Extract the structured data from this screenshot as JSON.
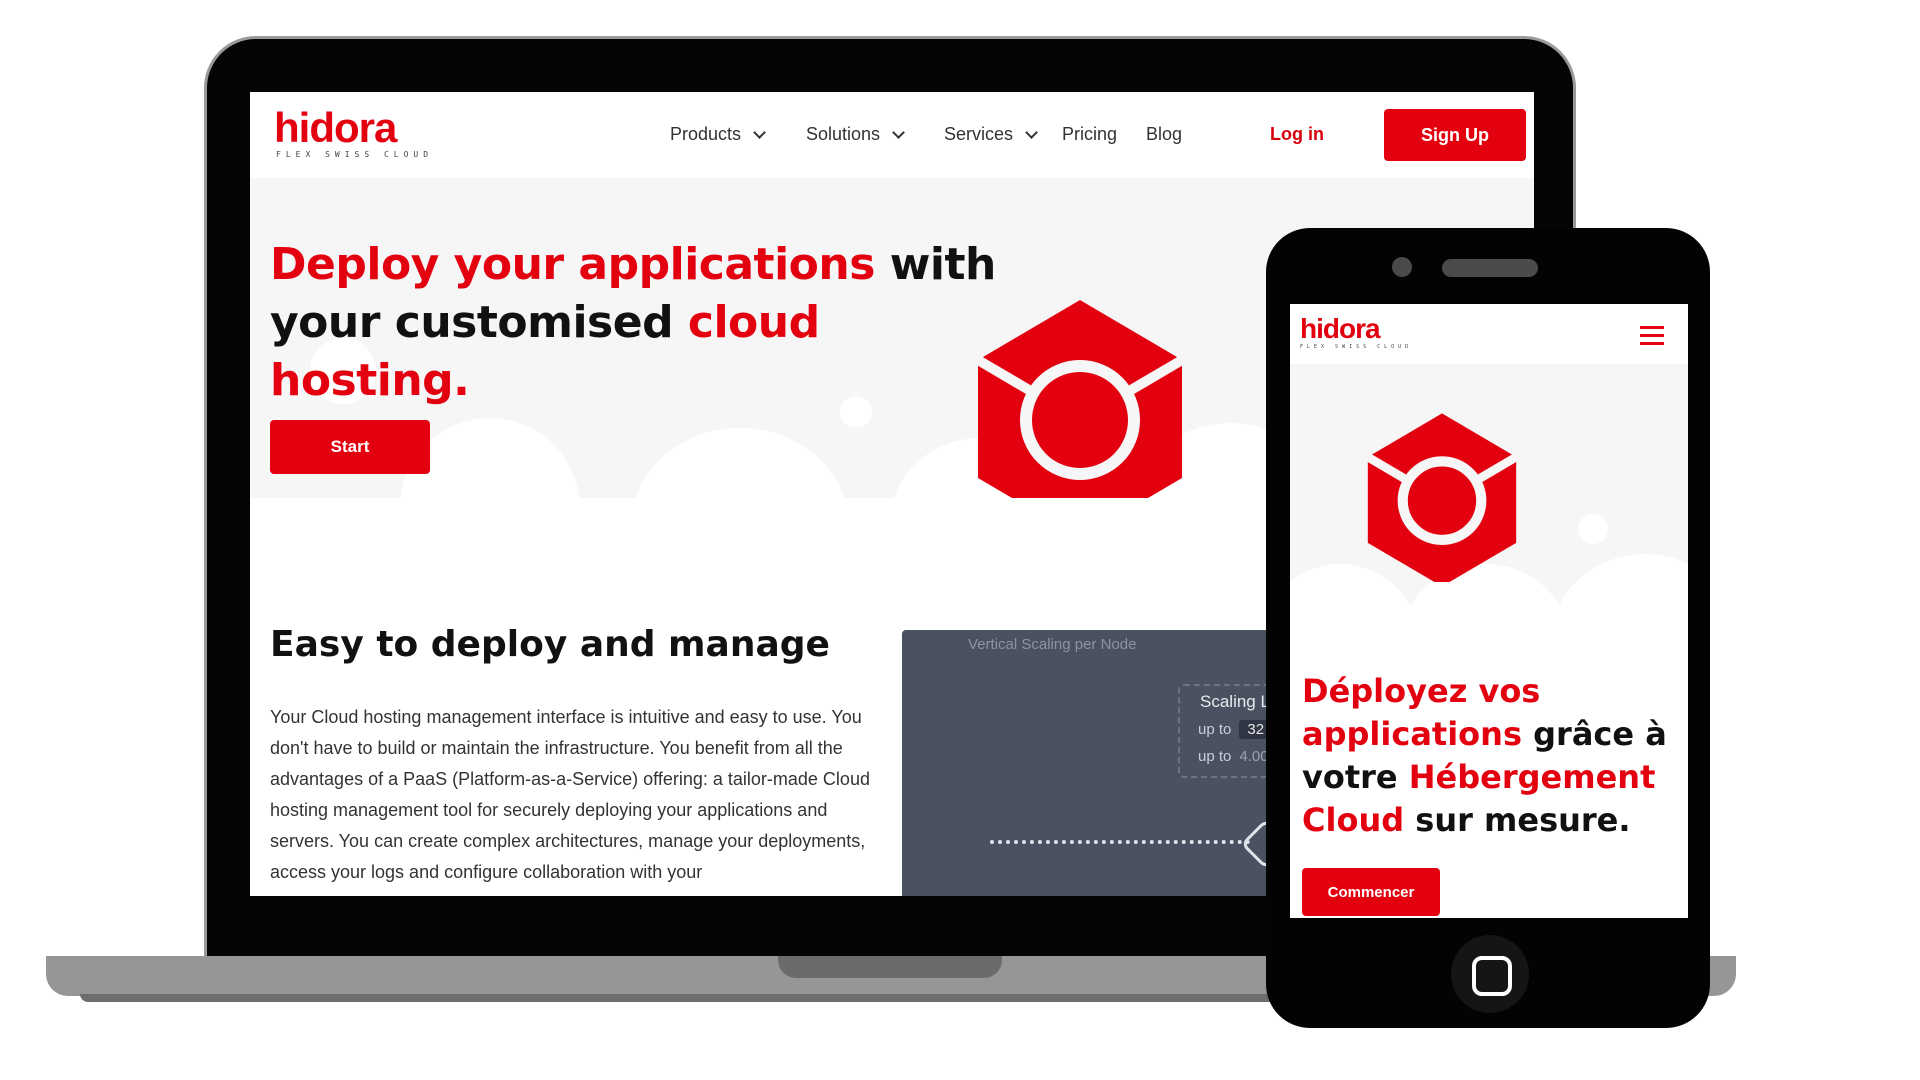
{
  "laptop": {
    "logo": {
      "word": "hidora",
      "tagline": "FLEX SWISS CLOUD"
    },
    "nav": {
      "items": [
        {
          "label": "Products",
          "has_dropdown": true
        },
        {
          "label": "Solutions",
          "has_dropdown": true
        },
        {
          "label": "Services",
          "has_dropdown": true
        },
        {
          "label": "Pricing",
          "has_dropdown": false
        },
        {
          "label": "Blog",
          "has_dropdown": false
        }
      ],
      "login_label": "Log in",
      "signup_label": "Sign Up"
    },
    "hero": {
      "title_red_1": "Deploy your applications",
      "title_dark_1": " with your customised ",
      "title_red_2": "cloud hosting.",
      "cta_label": "Start"
    },
    "section": {
      "title": "Easy to deploy and manage",
      "body": "Your Cloud hosting management interface is intuitive and easy to use. You don't have to build or maintain the infrastructure. You benefit from all the advantages of a PaaS (Platform-as-a-Service) offering: a tailor-made Cloud hosting management tool for securely deploying your applications and servers. You can create complex architectures, manage your deployments, access your logs and configure collaboration with your"
    },
    "scaling_panel": {
      "title": "Vertical Scaling per Node",
      "label": "Scaling L",
      "row1_prefix": "up to",
      "row1_value": "32",
      "row2_prefix": "up to",
      "row2_value": "4.00"
    }
  },
  "phone": {
    "logo": {
      "word": "hidora",
      "tagline": "FLEX SWISS CLOUD"
    },
    "hero": {
      "red_1": "Déployez vos applications",
      "dark_1": " grâce à votre ",
      "red_2": "Hébergement Cloud",
      "dark_2": " sur mesure.",
      "cta_label": "Commencer"
    }
  },
  "colors": {
    "brand_red": "#e3000f",
    "dark_text": "#111111",
    "hero_bg": "#f6f6f6",
    "panel_bg": "#4a5161"
  },
  "icons": [
    "hidora-logo-icon",
    "chevron-down-icon",
    "hamburger-menu-icon",
    "hidora-cube-icon",
    "home-button-icon"
  ]
}
